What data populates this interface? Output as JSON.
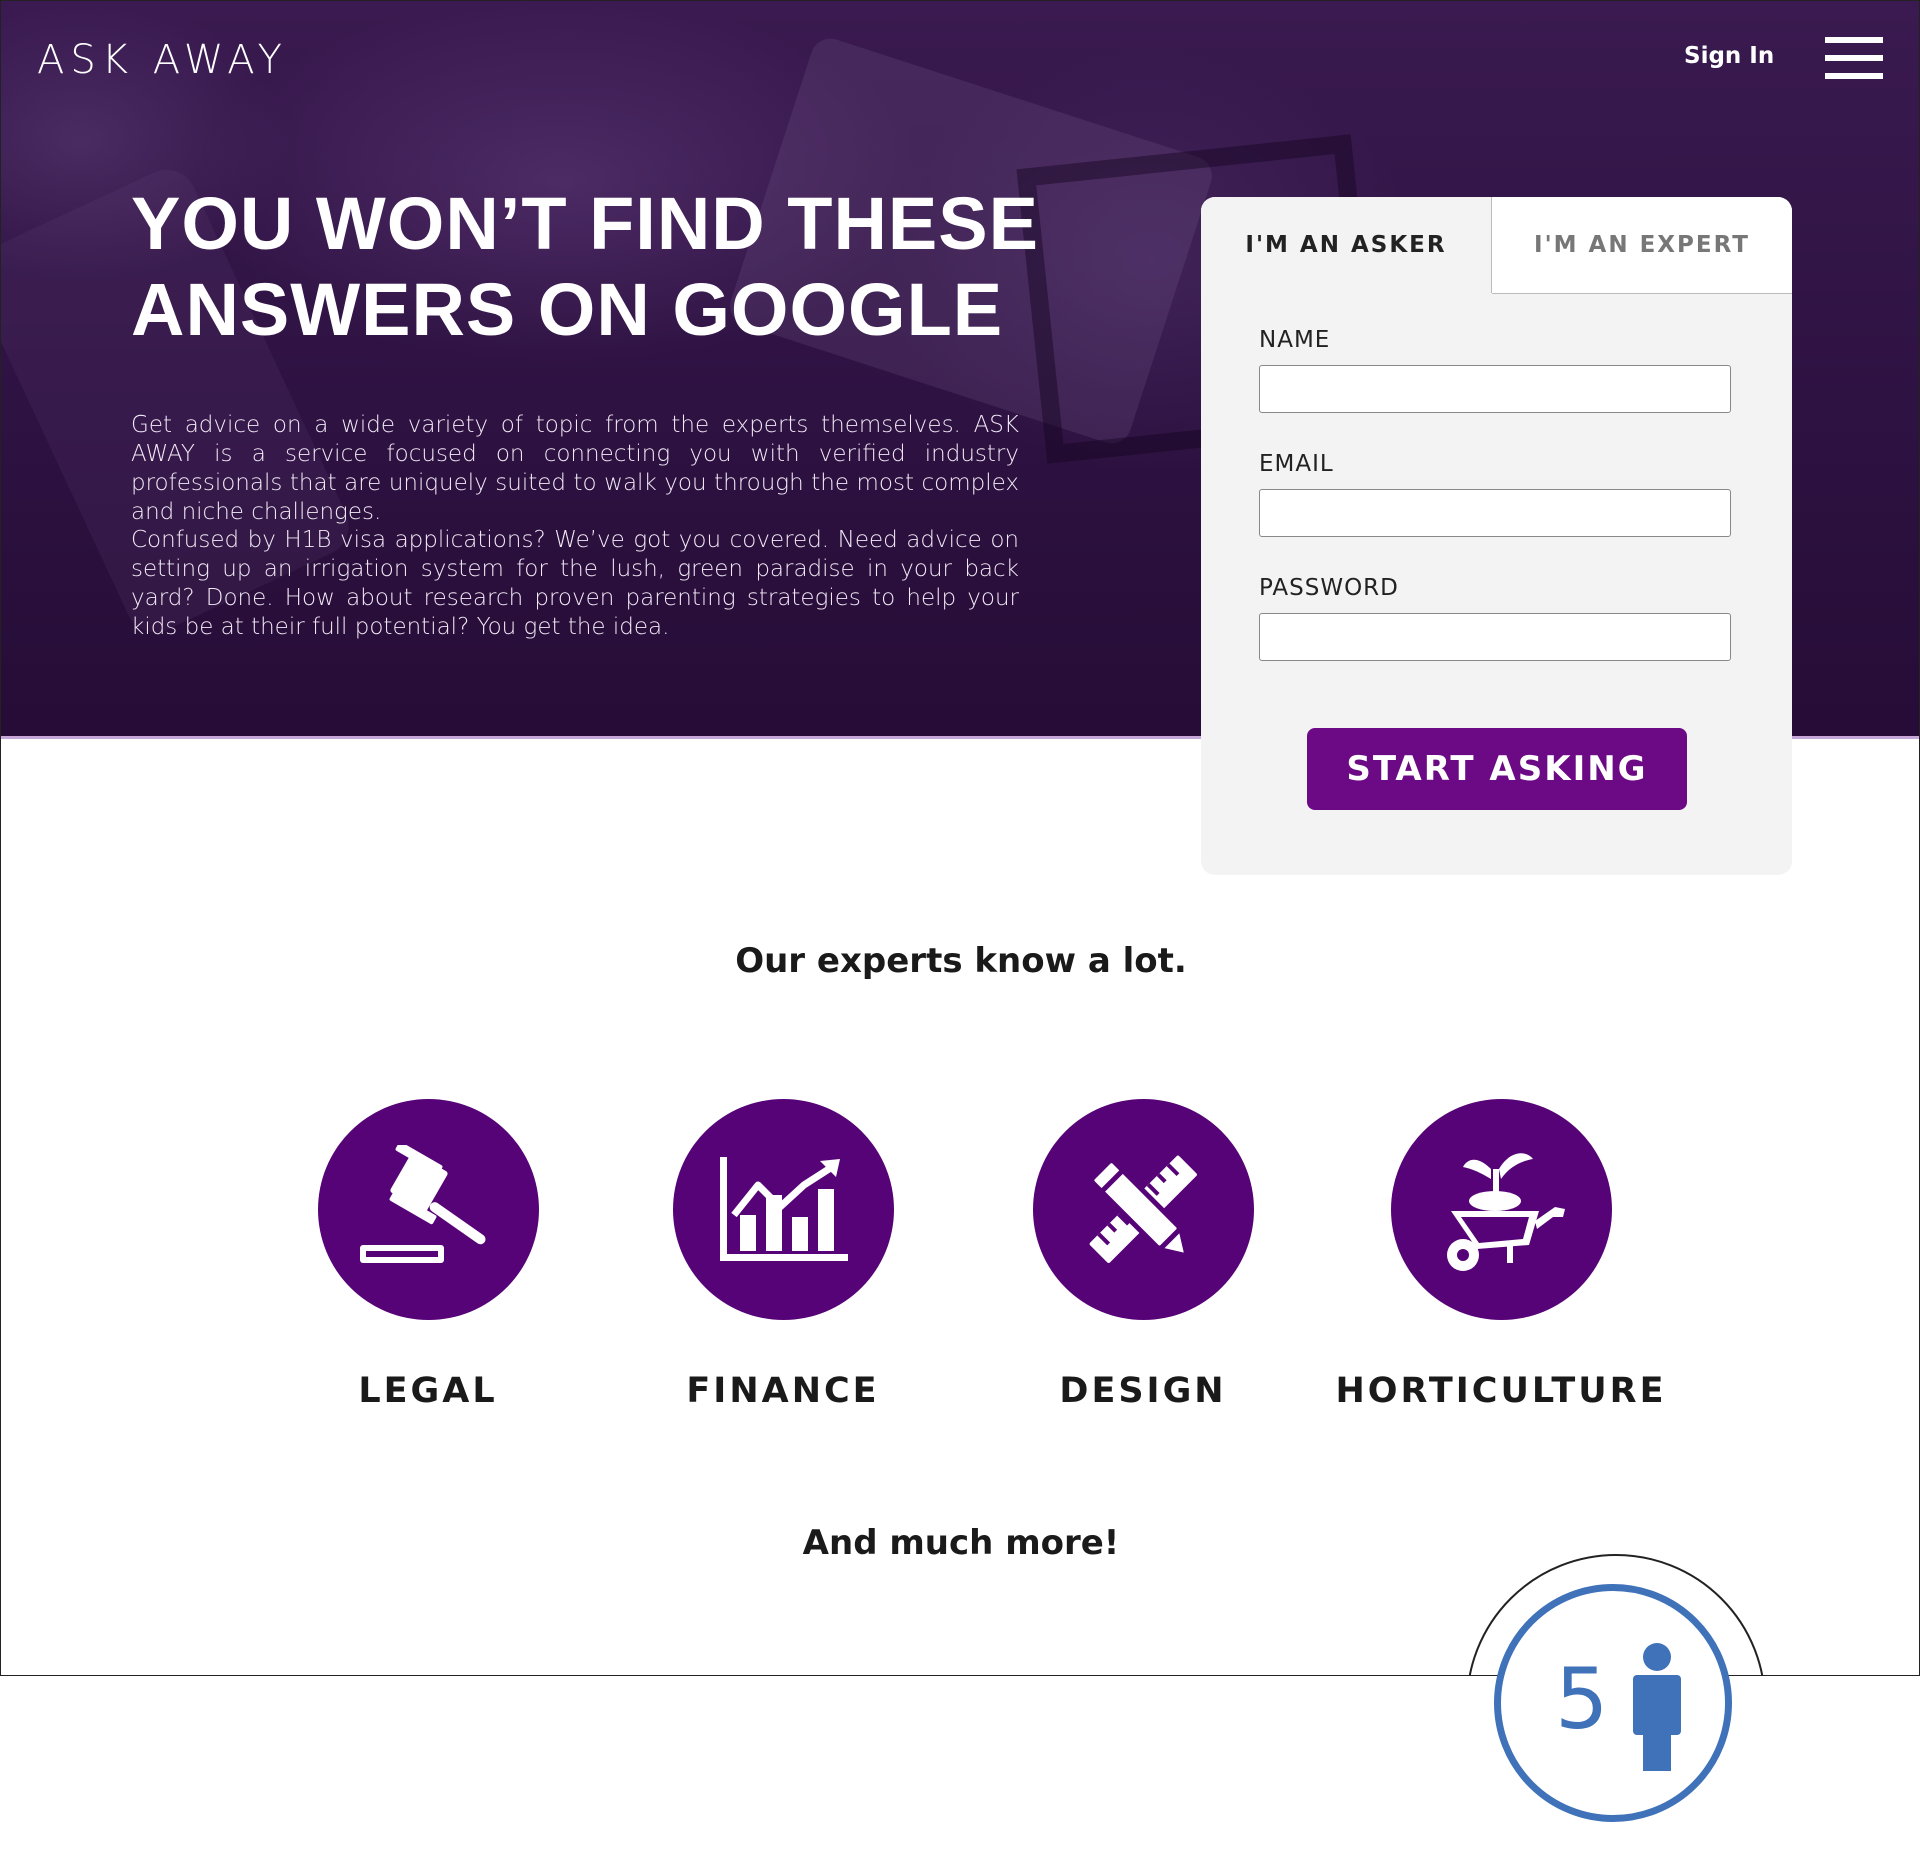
{
  "header": {
    "logo": "ASK AWAY",
    "sign_in_label": "Sign In"
  },
  "hero": {
    "headline": "YOU WON’T FIND THESE ANSWERS ON GOOGLE",
    "paragraph_1": "Get advice on a wide variety of topic from the experts themselves. ASK AWAY is a service focused on connecting you with verified industry professionals that are uniquely suited to walk you through the most complex and niche challenges.",
    "paragraph_2": "Confused by H1B visa applications? We’ve got you covered. Need advice on setting up an irrigation system for the lush, green paradise in your back yard? Done. How about research proven parenting strategies to help your kids be at their full potential? You get the idea."
  },
  "signup": {
    "tabs": [
      {
        "label": "I'M AN ASKER",
        "active": true
      },
      {
        "label": "I'M AN EXPERT",
        "active": false
      }
    ],
    "fields": [
      {
        "label": "NAME",
        "value": ""
      },
      {
        "label": "EMAIL",
        "value": ""
      },
      {
        "label": "PASSWORD",
        "value": ""
      }
    ],
    "submit_label": "START ASKING"
  },
  "experts": {
    "title": "Our experts know a lot.",
    "categories": [
      {
        "label": "LEGAL",
        "icon": "gavel-icon"
      },
      {
        "label": "FINANCE",
        "icon": "bar-chart-icon"
      },
      {
        "label": "DESIGN",
        "icon": "pencil-ruler-icon"
      },
      {
        "label": "HORTICULTURE",
        "icon": "wheelbarrow-plant-icon"
      }
    ],
    "footer": "And much more!"
  },
  "badge": {
    "number": "5",
    "icon": "person-icon"
  },
  "colors": {
    "brand_purple": "#560377",
    "button_purple": "#6c0a86",
    "badge_blue": "#3f72b8"
  }
}
